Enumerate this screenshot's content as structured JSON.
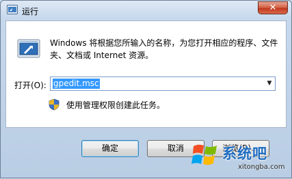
{
  "window": {
    "title": "运行",
    "close_glyph": "✕"
  },
  "dialog": {
    "description": "Windows 将根据您所输入的名称，为您打开相应的程序、文件夹、文档或 Internet 资源。",
    "open_label": "打开(O):",
    "command_value": "gpedit.msc",
    "admin_note": "使用管理权限创建此任务。"
  },
  "buttons": {
    "ok": "确定",
    "cancel": "取消",
    "browse": "浏览(B)..."
  },
  "icons": {
    "app": "run-icon",
    "shield": "uac-shield-icon",
    "dropdown": "chevron-down-icon"
  },
  "watermark": {
    "brand": "系统吧",
    "url": "xitongba.com"
  },
  "colors": {
    "selection": "#3399ff",
    "close_button": "#c0391d",
    "watermark_text": "#1d6cc0"
  }
}
